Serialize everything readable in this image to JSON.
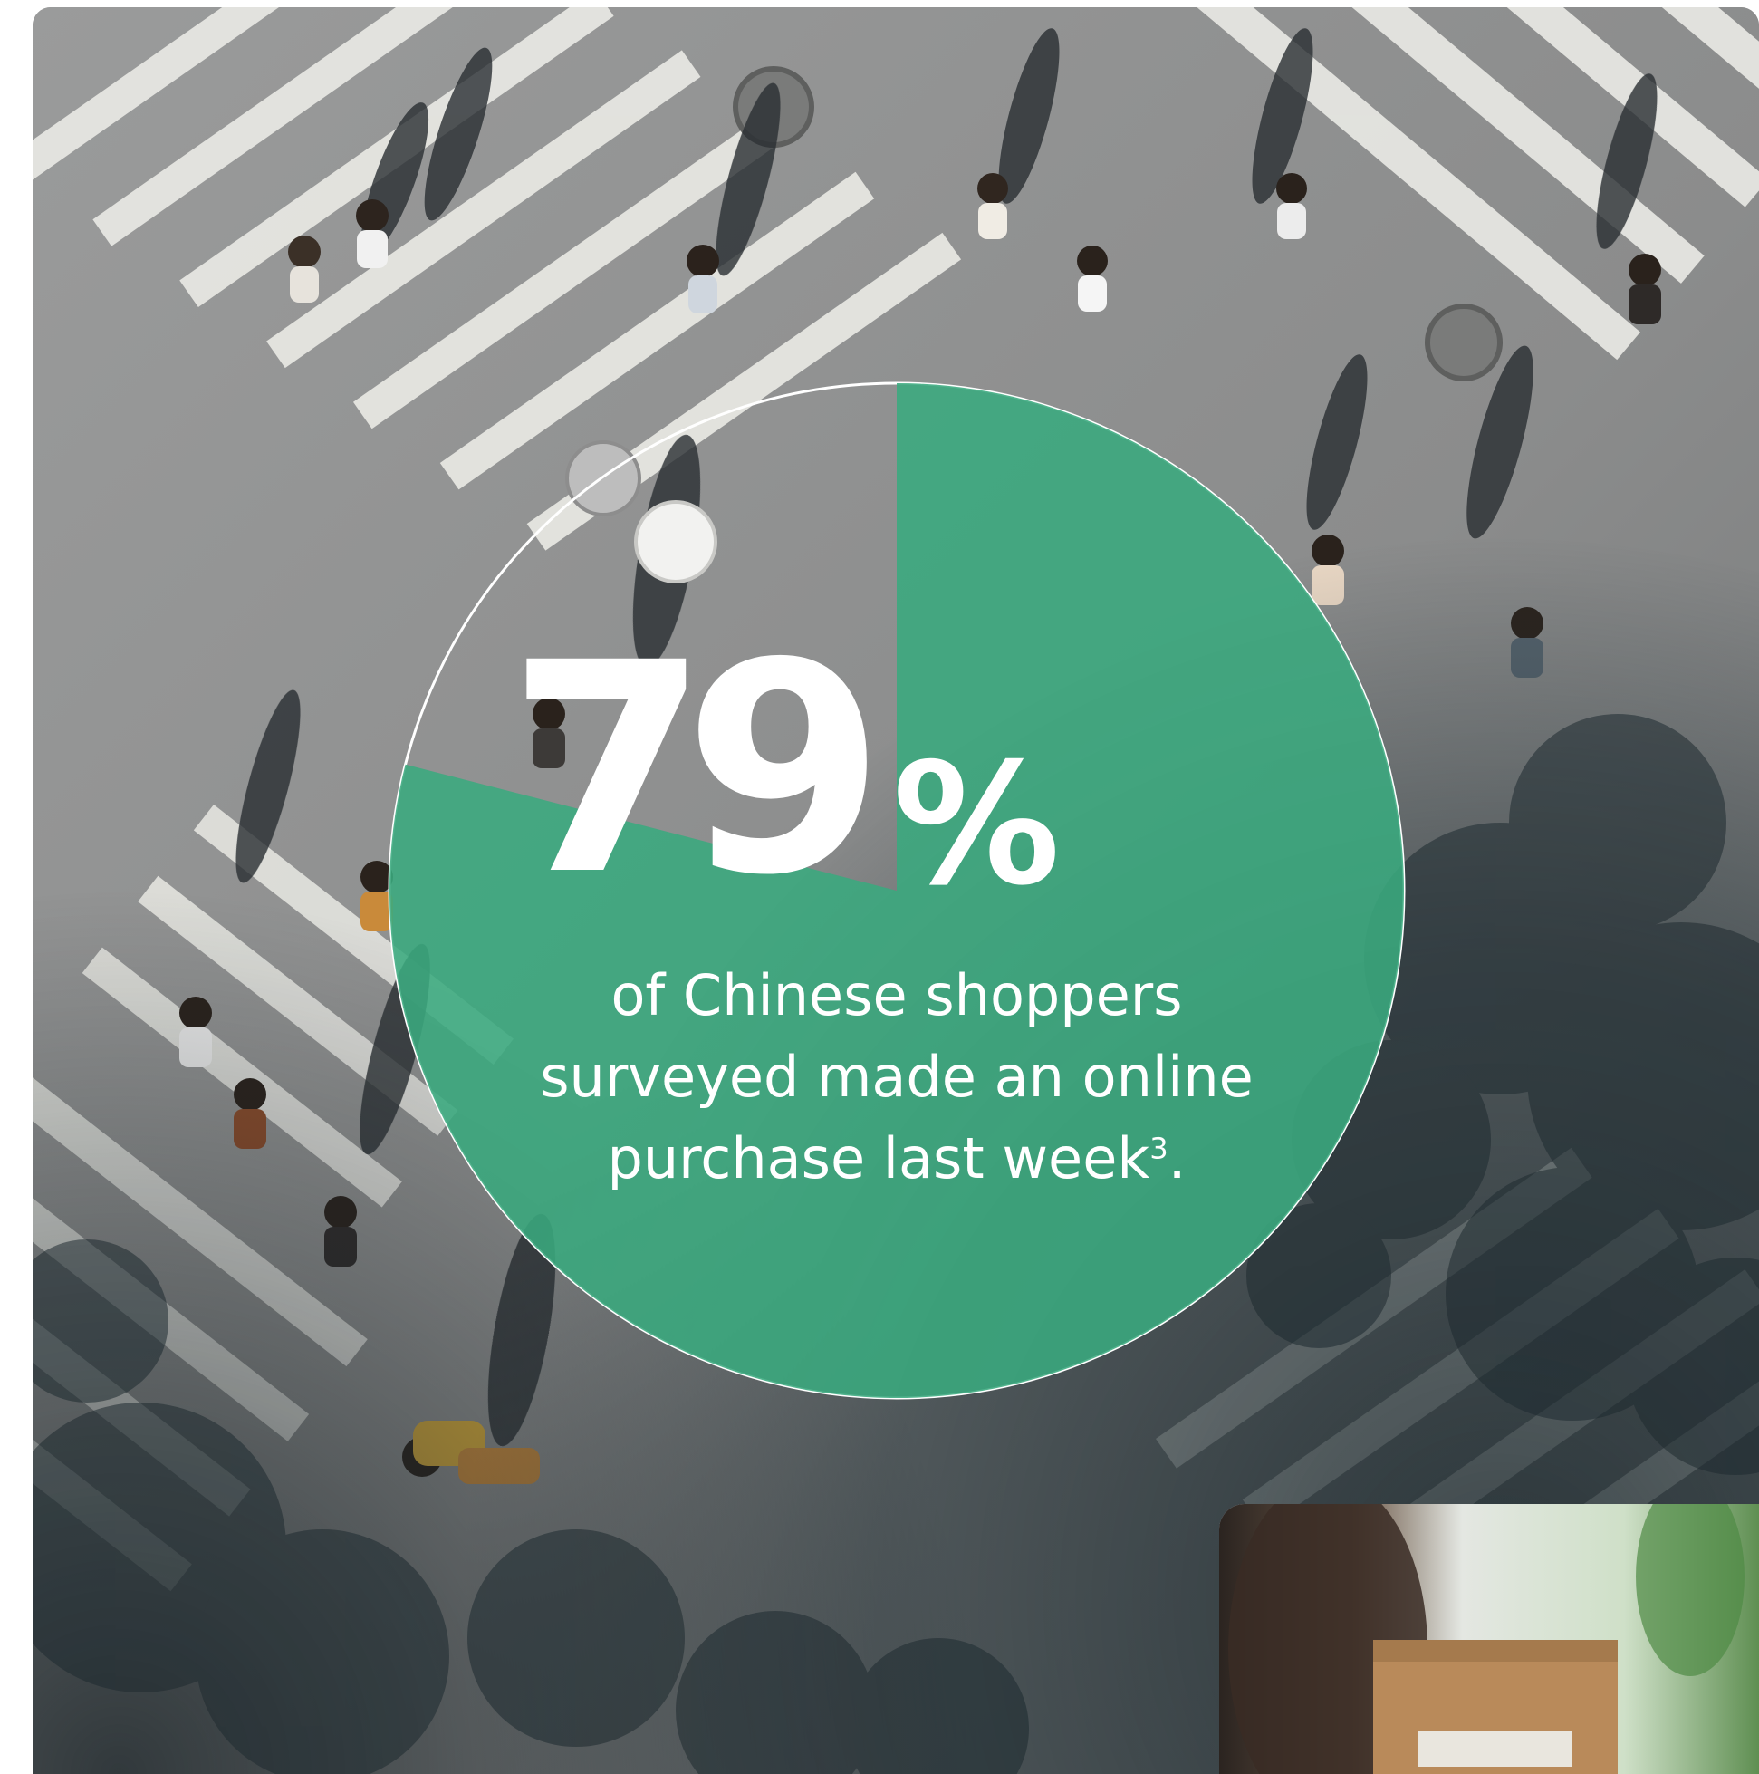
{
  "stat": {
    "number": "79",
    "percent_sign": "%",
    "caption": "of Chinese shoppers\nsurveyed made an online\npurchase last week",
    "footnote": "3",
    "caption_end": ".",
    "fill_fraction": 0.79
  },
  "colors": {
    "accent_green": "#3aaa7e",
    "ring_white": "#ffffff",
    "text_white": "#ffffff"
  },
  "images": {
    "background": "aerial-crosswalk-crowd-photo",
    "thumbnail": "person-holding-parcel-photo"
  }
}
